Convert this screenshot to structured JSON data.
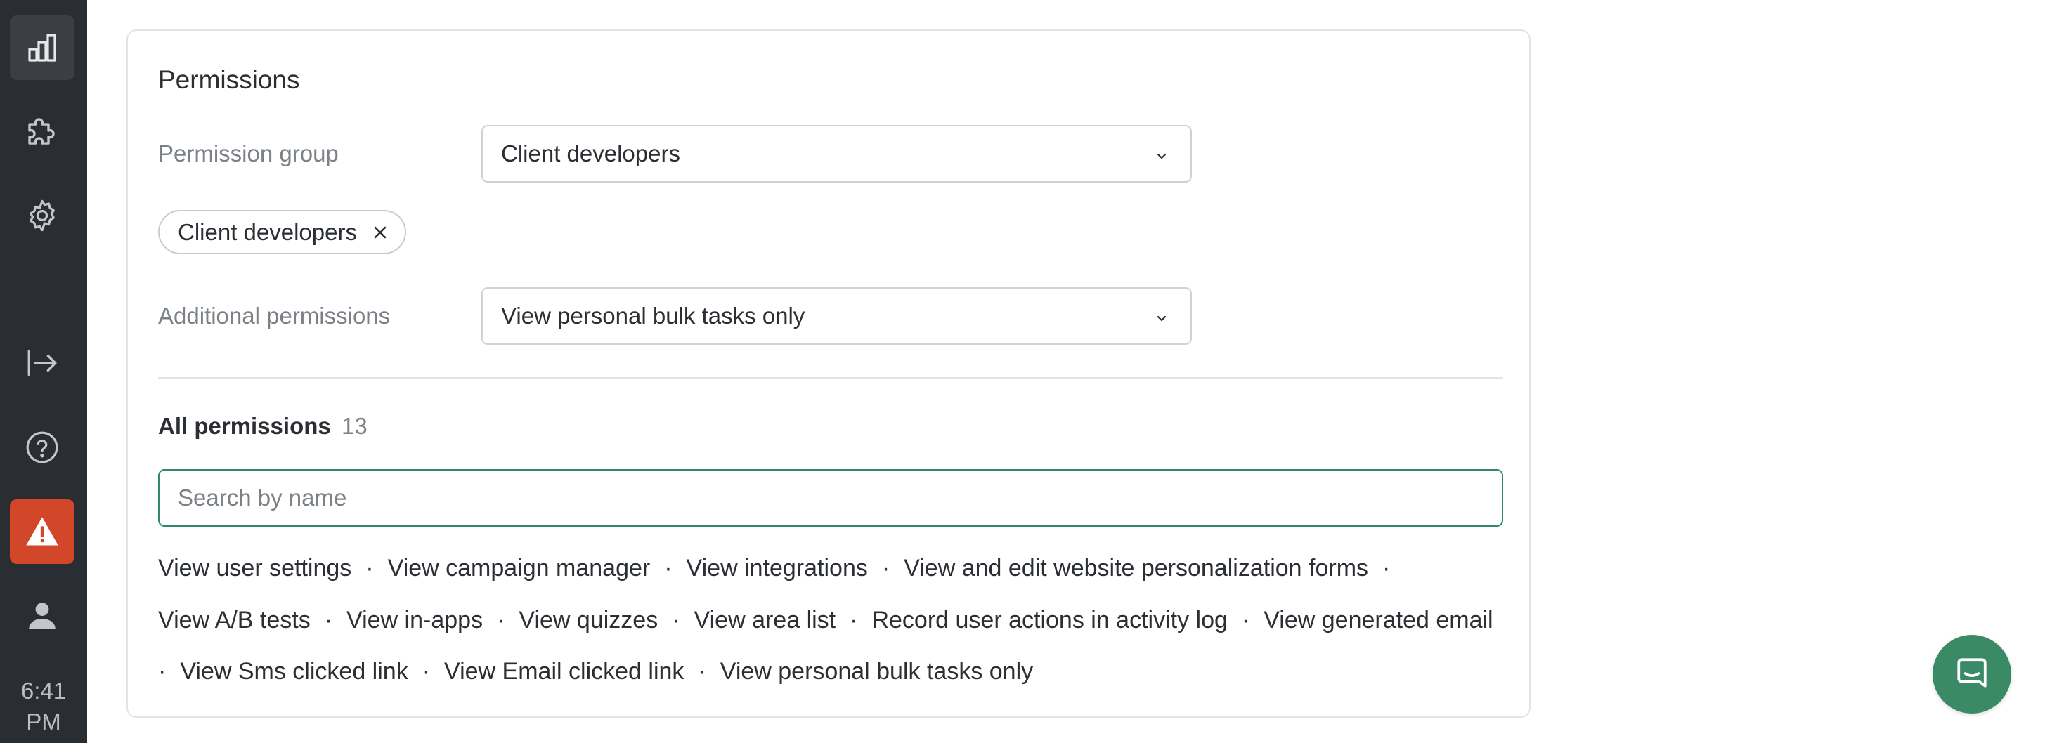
{
  "sidebar": {
    "items": [
      {
        "name": "analytics",
        "icon": "bar-chart-icon",
        "active": true
      },
      {
        "name": "integrations",
        "icon": "puzzle-icon",
        "active": false
      },
      {
        "name": "settings",
        "icon": "gear-icon",
        "active": false
      },
      {
        "name": "logout",
        "icon": "logout-arrow-icon",
        "active": false
      },
      {
        "name": "help",
        "icon": "question-circle-icon",
        "active": false
      },
      {
        "name": "alert",
        "icon": "warning-triangle-icon",
        "active": false
      },
      {
        "name": "profile",
        "icon": "user-icon",
        "active": false
      }
    ],
    "time_hm": "6:41",
    "time_ampm": "PM"
  },
  "permissions": {
    "title": "Permissions",
    "group_label": "Permission group",
    "group_value": "Client developers",
    "chip_label": "Client developers",
    "additional_label": "Additional permissions",
    "additional_value": "View personal bulk tasks only",
    "all_title": "All permissions",
    "all_count": "13",
    "search_placeholder": "Search by name",
    "items": [
      "View user settings",
      "View campaign manager",
      "View integrations",
      "View and edit website personalization forms",
      "View A/B tests",
      "View in-apps",
      "View quizzes",
      "View area list",
      "Record user actions in activity log",
      "View generated email",
      "View Sms clicked link",
      "View Email clicked link",
      "View personal bulk tasks only"
    ],
    "separator": "·"
  },
  "colors": {
    "sidebar_bg": "#2a2d31",
    "active_item_bg": "#3b3f44",
    "alert_bg": "#d2462a",
    "accent_green": "#2f8a63",
    "chat_bg": "#3b8a66"
  },
  "chat": {
    "icon": "chat-bubble-icon"
  }
}
